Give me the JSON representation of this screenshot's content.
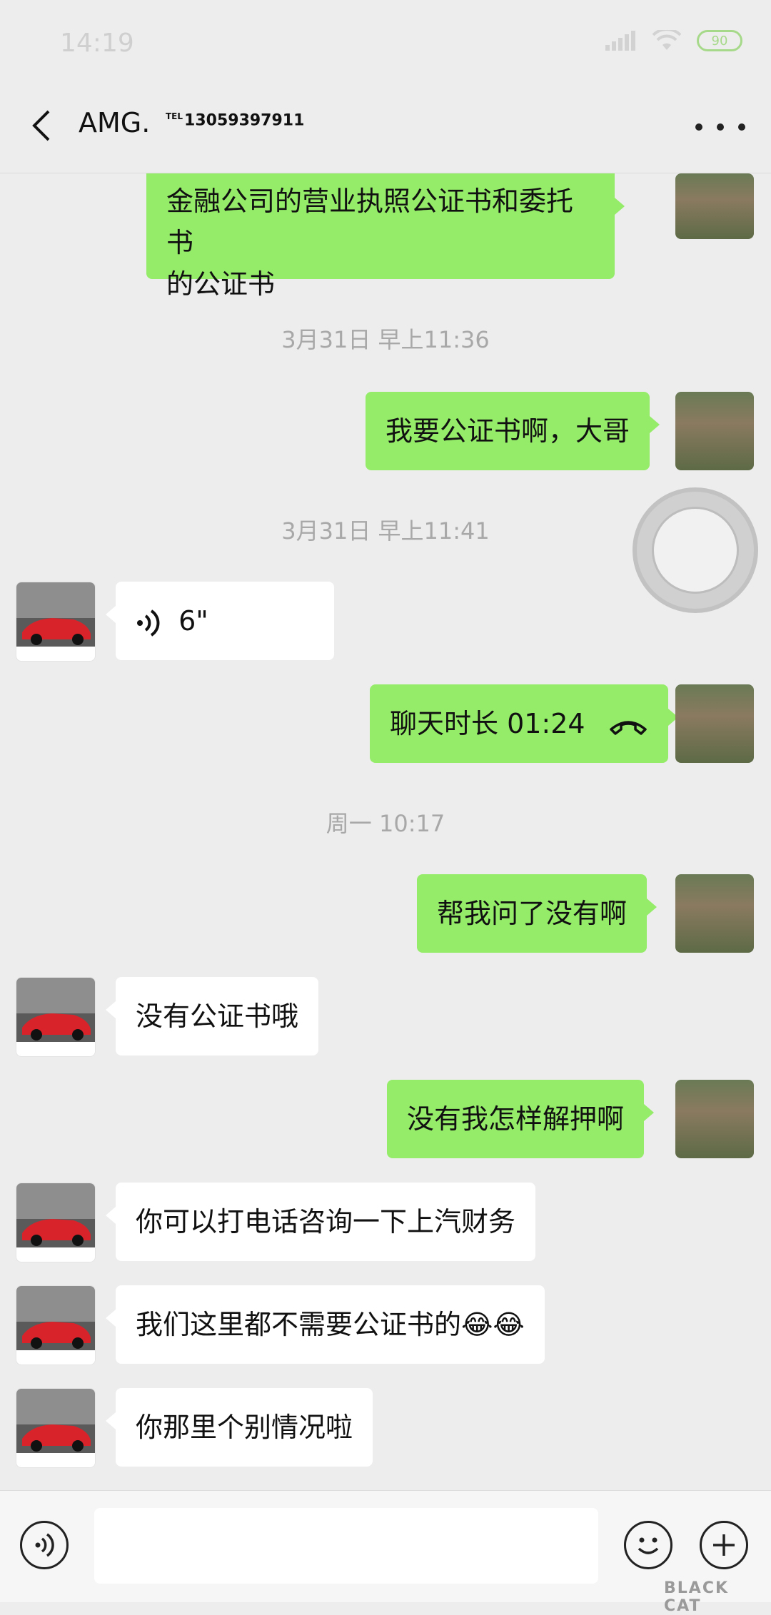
{
  "status": {
    "time": "14:19",
    "battery": "90"
  },
  "header": {
    "name": "AMG.",
    "tel_tag": "TEL",
    "tel": "13059397911"
  },
  "messages": [
    {
      "side": "out",
      "text_line1": "金融公司的营业执照公证书和委托书",
      "text_line2": "的公证书"
    },
    {
      "timestamp": "3月31日 早上11:36"
    },
    {
      "side": "out",
      "text": "我要公证书啊，大哥"
    },
    {
      "timestamp": "3月31日 早上11:41"
    },
    {
      "side": "in",
      "voice_duration": "6\""
    },
    {
      "side": "out",
      "call_text": "聊天时长 01:24"
    },
    {
      "timestamp": "周一 10:17"
    },
    {
      "side": "out",
      "text": "帮我问了没有啊"
    },
    {
      "side": "in",
      "text": "没有公证书哦"
    },
    {
      "side": "out",
      "text": "没有我怎样解押啊"
    },
    {
      "side": "in",
      "text": "你可以打电话咨询一下上汽财务"
    },
    {
      "side": "in",
      "text": "我们这里都不需要公证书的😂😂"
    },
    {
      "side": "in",
      "text": "你那里个别情况啦"
    }
  ],
  "input": {
    "placeholder": ""
  },
  "watermark": "BLACK CAT"
}
